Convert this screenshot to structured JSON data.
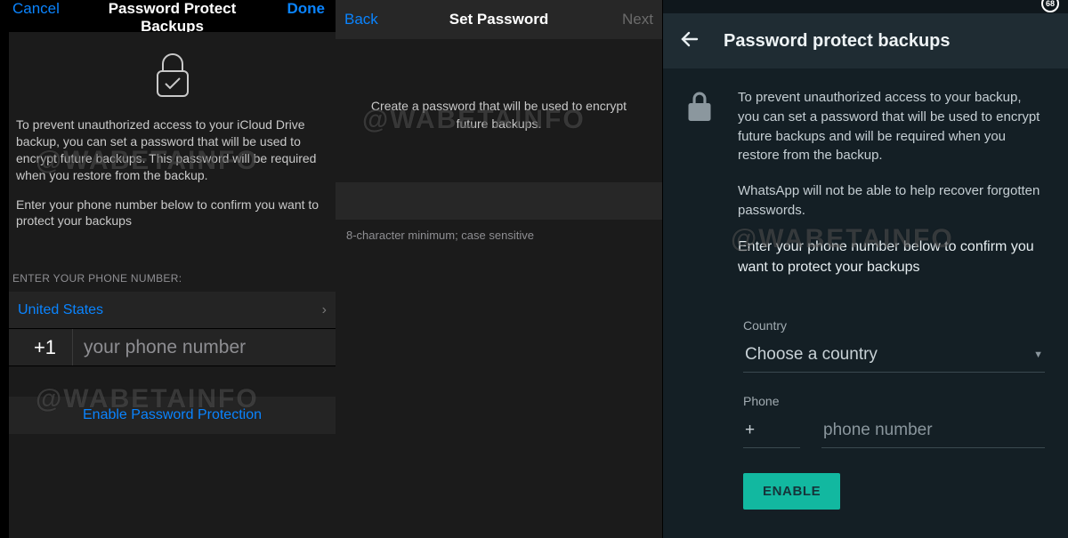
{
  "watermark": "@WABETAINFO",
  "pane1": {
    "nav": {
      "cancel": "Cancel",
      "title": "Password Protect Backups",
      "done": "Done"
    },
    "body": {
      "p1": "To prevent unauthorized access to your iCloud Drive backup, you can set a password that will be used to encrypt future backups. This password will be required when you restore from the backup.",
      "p2": "Enter your phone number below to confirm you want to protect your backups"
    },
    "section_label": "ENTER YOUR PHONE NUMBER:",
    "country": "United States",
    "country_code": "+1",
    "phone_placeholder": "your phone number",
    "enable": "Enable Password Protection"
  },
  "pane2": {
    "nav": {
      "back": "Back",
      "title": "Set Password",
      "next": "Next"
    },
    "subtitle": "Create a password that will be used to encrypt future backups.",
    "hint": "8-character minimum; case sensitive"
  },
  "pane3": {
    "badge": "68",
    "title": "Password protect backups",
    "p1": "To prevent unauthorized access to your backup, you can set a password that will be used to encrypt future backups and will be required when you restore from the backup.",
    "p2": "WhatsApp will not be able to help recover forgotten passwords.",
    "p3": "Enter your phone number below to confirm you want to protect your backups",
    "country_label": "Country",
    "country_placeholder": "Choose a country",
    "phone_label": "Phone",
    "phone_cc": "+",
    "phone_placeholder": "phone number",
    "enable": "ENABLE"
  }
}
